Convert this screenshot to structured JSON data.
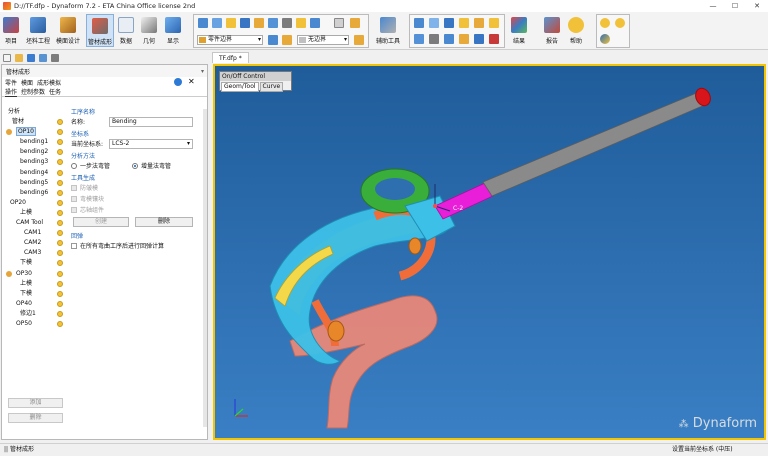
{
  "window": {
    "title": "D://TF.dfp - Dynaform 7.2  - ETA China Office license 2nd",
    "controls": [
      "—",
      "☐",
      "✕"
    ]
  },
  "ribbon": {
    "buttons": [
      {
        "label": "项目",
        "color": "#2d6db5"
      },
      {
        "label": "坯料工程",
        "color": "#3a7cc3"
      },
      {
        "label": "模面设计",
        "color": "#d28b2a"
      },
      {
        "label": "管材成形",
        "color": "#c24a3a"
      },
      {
        "label": "数据",
        "color": "#5a93d1"
      },
      {
        "label": "几何",
        "color": "#6c6c6c"
      },
      {
        "label": "显示",
        "color": "#4a86c8"
      },
      {
        "label": "辅助工具",
        "color": "#3c78bf"
      },
      {
        "label": "结果",
        "color": "#c83a3a"
      },
      {
        "label": "报告",
        "color": "#3c78bf"
      },
      {
        "label": "帮助",
        "color": "#e3a925"
      }
    ],
    "combo_part_boundary": "零件边界",
    "combo_no_boundary": "无边界"
  },
  "document_tab": "TF.dfp *",
  "panel": {
    "title": "管材成形",
    "tabs1": [
      "零件",
      "模面",
      "成形模拟"
    ],
    "tabs2": [
      "操作",
      "控制参数",
      "任务"
    ],
    "tree": [
      "分析",
      "管材",
      "OP10",
      "bending1",
      "bending2",
      "bending3",
      "bending4",
      "bending5",
      "bending6",
      "OP20",
      "上模",
      "CAM Tool",
      "CAM1",
      "CAM2",
      "CAM3",
      "下模",
      "OP30",
      "上模",
      "下模",
      "OP40",
      "修边1",
      "OP50"
    ],
    "props": {
      "section_process_name": "工序名称",
      "name_label": "名称:",
      "name_value": "Bending",
      "section_coords": "坐标系",
      "coord_label": "当前坐标系:",
      "coord_value": "LCS-2",
      "section_method": "分析方法",
      "radio_one_step": "一步法弯管",
      "radio_incremental": "增量法弯管",
      "section_tool_gen": "工具生成",
      "chk_anti_wrinkle": "防皱模",
      "chk_wiper": "弯模镶块",
      "chk_mandrel": "芯轴组件",
      "btn_create": "创建",
      "btn_delete": "删除",
      "section_springback": "回弹",
      "chk_springback": "在所有弯曲工序后进行回弹计算"
    },
    "btn_add": "添加",
    "btn_remove": "删除"
  },
  "viewport": {
    "onoff_title": "On/Off Control",
    "onoff_tabs": [
      "Geom/Tool",
      "Curve"
    ],
    "triad_label": "C-2",
    "logo": "Dynaform"
  },
  "status": {
    "left": "|| 管材成形",
    "right": "设置当前坐标系 (中压)"
  }
}
